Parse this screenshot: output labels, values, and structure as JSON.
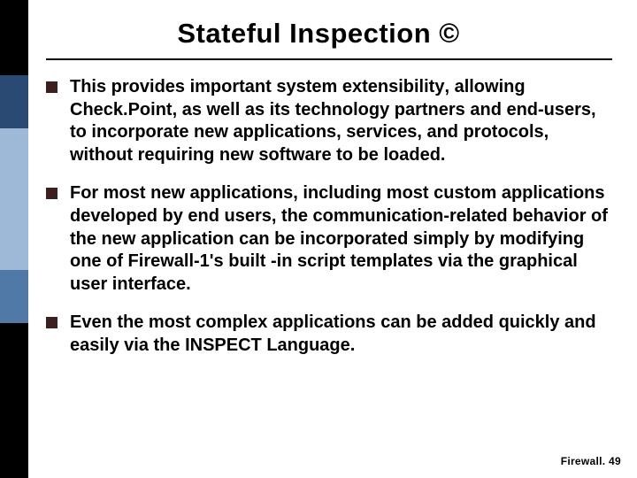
{
  "title": "Stateful Inspection ©",
  "bullets": [
    {
      "pre": "This provides important ",
      "bold": "system extensibility",
      "post": ", allowing Check.Point, as well as its technology partners and end-users, to incorporate new applications, services, and protocols, without requiring new software to be loaded."
    },
    {
      "pre": "For most new applications, including most custom applications developed by end users, ",
      "bold": "the communication-related behavior of the new application can be incorporated",
      "post": " simply by modifying one of Firewall-1's built -in script templates via the graphical user interface."
    },
    {
      "pre": "Even the most complex applications can be added quickly and easily via the INSPECT Language.",
      "bold": "",
      "post": ""
    }
  ],
  "footer": "Firewall. 49"
}
